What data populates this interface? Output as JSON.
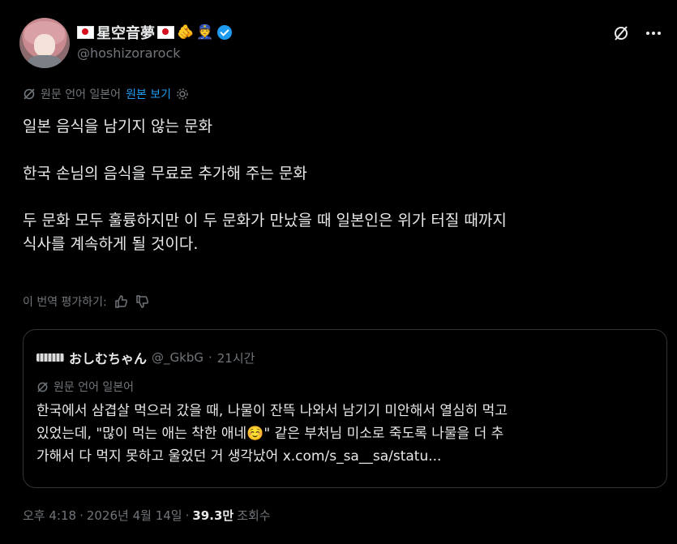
{
  "user": {
    "display_name": "星空音夢",
    "handle": "@hoshizorarock",
    "flag_emoji": "🇯🇵",
    "emoji_1": "🫵",
    "emoji_2": "👮"
  },
  "translation": {
    "note": "원문 언어 일본어",
    "view_original": "원본 보기"
  },
  "tweet": {
    "lines": [
      "일본 음식을 남기지 않는 문화",
      "한국 손님의 음식을 무료로 추가해 주는 문화",
      "두 문화 모두 훌륭하지만 이 두 문화가 만났을 때 일본인은 위가 터질 때까지",
      "식사를 계속하게 될 것이다."
    ]
  },
  "rate": {
    "label": "이 번역 평가하기:"
  },
  "quote": {
    "name": "おしむちゃん",
    "handle": "@_GkbG",
    "separator": "·",
    "time": "21시간",
    "note": "원문 언어 일본어",
    "text_line1": "한국에서 삼겹살 먹으러 갔을 때, 나물이 잔뜩 나와서 남기기 미안해서 열심히 먹고",
    "text_line2": "있었는데, \"많이 먹는 애는 착한 애네☺️\" 같은 부처님 미소로 죽도록 나물을 더 추",
    "text_line3": "가해서 다 먹지 못하고 울었던 거 생각났어 x.com/s_sa__sa/statu..."
  },
  "footer": {
    "time": "오후 4:18",
    "date": "2026년 4월 14일",
    "dot": "·",
    "views_count": "39.3만",
    "views_label": "조회수"
  },
  "colors": {
    "background": "#000000",
    "text": "#e7e9ea",
    "muted": "#71767b",
    "accent": "#1d9bf0",
    "border": "#2f3336"
  }
}
